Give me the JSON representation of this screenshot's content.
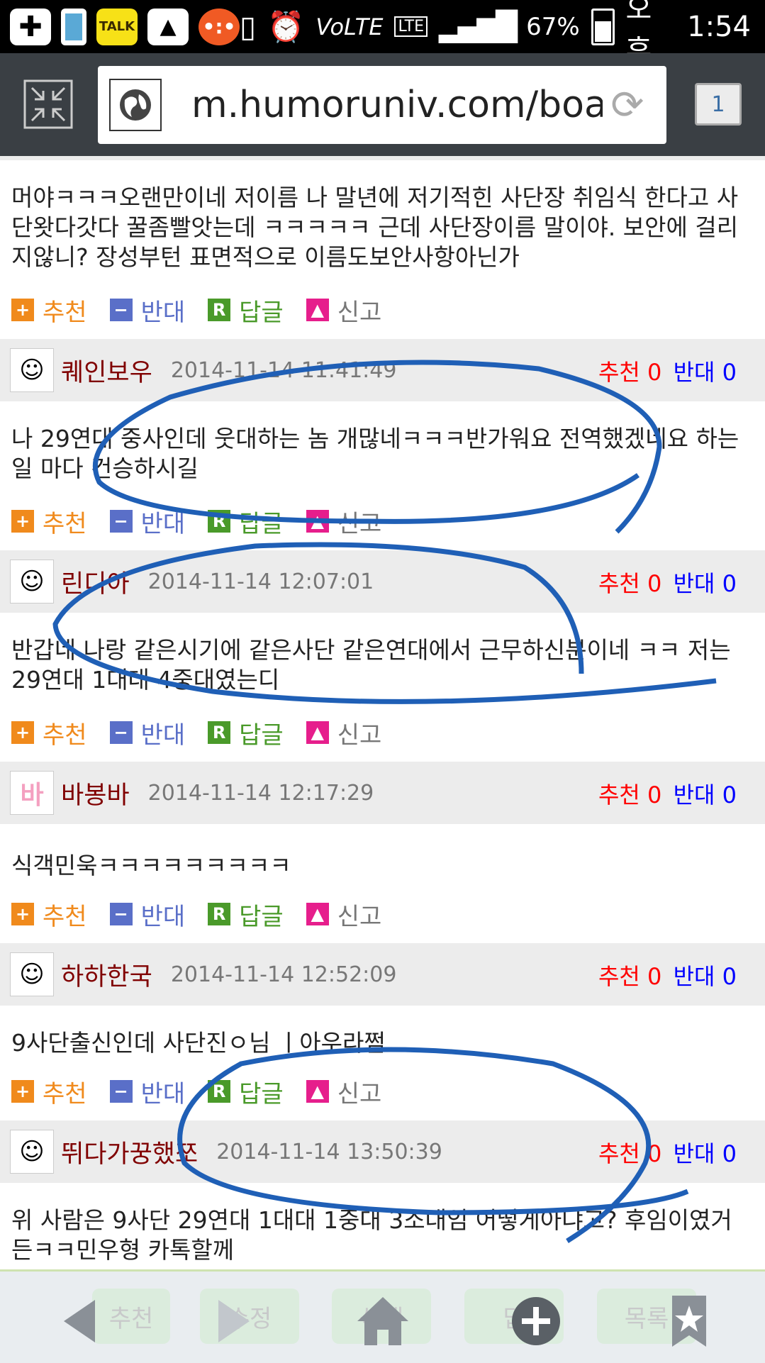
{
  "status": {
    "battery": "67%",
    "time_prefix": "오후",
    "time": "1:54",
    "network": "LTE"
  },
  "browser": {
    "url": "m.humoruniv.com/board/",
    "tab_count": "1"
  },
  "actions": {
    "recommend": "추천",
    "oppose": "반대",
    "reply": "답글",
    "report": "신고"
  },
  "vote_labels": {
    "recommend": "추천",
    "oppose": "반대"
  },
  "colors": {
    "author": "#800000",
    "recommend": "#ff0000",
    "oppose": "#0000ff",
    "annotation": "#1f5fb6"
  },
  "first_comment": {
    "body": "머야ㅋㅋㅋ오랜만이네 저이름 나 말년에 저기적힌 사단장 취임식 한다고 사단왓다갓다 꿀좀빨앗는데 ㅋㅋㅋㅋㅋ 근데 사단장이름 말이야. 보안에 걸리지않니? 장성부턴 표면적으로 이름도보안사항아닌가"
  },
  "comments": [
    {
      "author": "퀘인보우",
      "date": "2014-11-14 11:41:49",
      "recommend": "0",
      "oppose": "0",
      "body": "나 29연대 중사인데 웃대하는 놈 개많네ㅋㅋㅋ반가워요 전역했겠네요 하는 일 마다 건승하시길"
    },
    {
      "author": "린디아",
      "date": "2014-11-14 12:07:01",
      "recommend": "0",
      "oppose": "0",
      "body": "반갑네 나랑 같은시기에 같은사단 같은연대에서 근무하신분이네 ㅋㅋ 저는 29연대 1대대 4중대였는디"
    },
    {
      "author": "바봉바",
      "date": "2014-11-14 12:17:29",
      "recommend": "0",
      "oppose": "0",
      "body": "식객민욱ㅋㅋㅋㅋㅋㅋㅋㅋㅋ"
    },
    {
      "author": "하하한국",
      "date": "2014-11-14 12:52:09",
      "recommend": "0",
      "oppose": "0",
      "body": "9사단출신인데 사단진ㅇ님 ㅣ아우라쩜"
    },
    {
      "author": "뛰다가꿍했쪼",
      "date": "2014-11-14 13:50:39",
      "recommend": "0",
      "oppose": "0",
      "body": "위 사람은 9사단 29연대 1대대 1중대 3소대임 어떻게아냐고? 후임이였거든ㅋㅋ민우형 카톡할께"
    }
  ],
  "bottom": {
    "ghost_recommend": "추천",
    "ghost_edit": "수정",
    "ghost_delete": "삭제",
    "ghost_reply": "답",
    "ghost_list": "목록"
  }
}
